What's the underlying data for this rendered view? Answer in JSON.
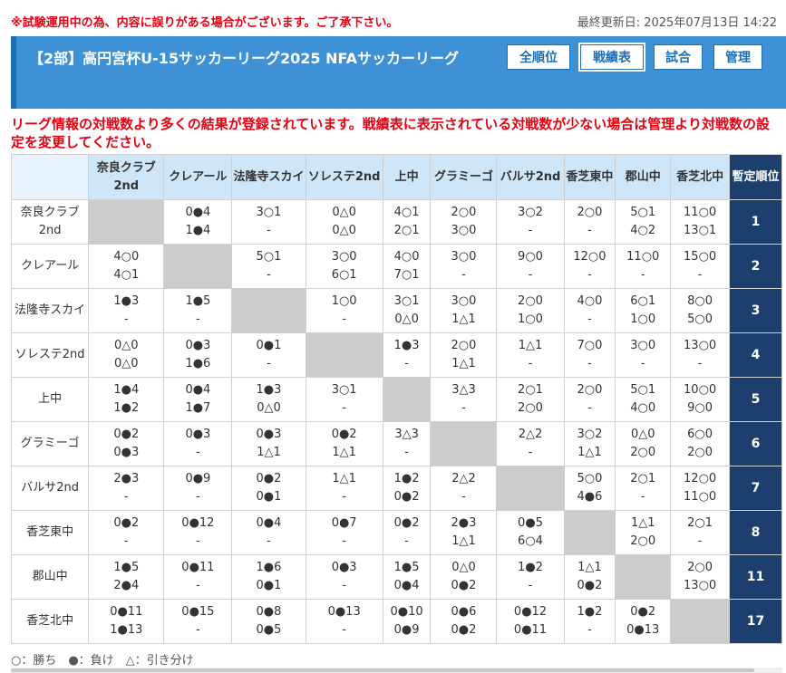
{
  "notice": "※試験運用中の為、内容に誤りがある場合がございます。ご了承下さい。",
  "updated": "最終更新日: 2025年07月13日 14:22",
  "league_title": "【2部】高円宮杯U-15サッカーリーグ2025 NFAサッカーリーグ",
  "nav": [
    "全順位",
    "戦績表",
    "試合",
    "管理"
  ],
  "warning": "リーグ情報の対戦数より多くの結果が登録されています。戦績表に表示されている対戦数が少ない場合は管理より対戦数の設定を変更してください。",
  "columns": [
    "奈良クラブ2nd",
    "クレアール",
    "法隆寺スカイ",
    "ソレステ2nd",
    "上中",
    "グラミーゴ",
    "バルサ2nd",
    "香芝東中",
    "郡山中",
    "香芝北中"
  ],
  "rank_header": "暫定順位",
  "rows": [
    {
      "team": "奈良クラブ2nd",
      "rank": "1",
      "cells": [
        null,
        [
          "0●4",
          "1●4"
        ],
        [
          "3○1",
          "-"
        ],
        [
          "0△0",
          "0△0"
        ],
        [
          "4○1",
          "2○1"
        ],
        [
          "2○0",
          "3○0"
        ],
        [
          "3○2",
          "-"
        ],
        [
          "2○0",
          "-"
        ],
        [
          "5○1",
          "4○2"
        ],
        [
          "11○0",
          "13○1"
        ]
      ]
    },
    {
      "team": "クレアール",
      "rank": "2",
      "cells": [
        [
          "4○0",
          "4○1"
        ],
        null,
        [
          "5○1",
          "-"
        ],
        [
          "3○0",
          "6○1"
        ],
        [
          "4○0",
          "7○1"
        ],
        [
          "3○0",
          "-"
        ],
        [
          "9○0",
          "-"
        ],
        [
          "12○0",
          "-"
        ],
        [
          "11○0",
          "-"
        ],
        [
          "15○0",
          "-"
        ]
      ]
    },
    {
      "team": "法隆寺スカイ",
      "rank": "3",
      "cells": [
        [
          "1●3",
          "-"
        ],
        [
          "1●5",
          "-"
        ],
        null,
        [
          "1○0",
          "-"
        ],
        [
          "3○1",
          "0△0"
        ],
        [
          "3○0",
          "1△1"
        ],
        [
          "2○0",
          "1○0"
        ],
        [
          "4○0",
          "-"
        ],
        [
          "6○1",
          "1○0"
        ],
        [
          "8○0",
          "5○0"
        ]
      ]
    },
    {
      "team": "ソレステ2nd",
      "rank": "4",
      "cells": [
        [
          "0△0",
          "0△0"
        ],
        [
          "0●3",
          "1●6"
        ],
        [
          "0●1",
          "-"
        ],
        null,
        [
          "1●3",
          "-"
        ],
        [
          "2○0",
          "1△1"
        ],
        [
          "1△1",
          "-"
        ],
        [
          "7○0",
          "-"
        ],
        [
          "3○0",
          "-"
        ],
        [
          "13○0",
          "-"
        ]
      ]
    },
    {
      "team": "上中",
      "rank": "5",
      "cells": [
        [
          "1●4",
          "1●2"
        ],
        [
          "0●4",
          "1●7"
        ],
        [
          "1●3",
          "0△0"
        ],
        [
          "3○1",
          "-"
        ],
        null,
        [
          "3△3",
          "-"
        ],
        [
          "2○1",
          "2○0"
        ],
        [
          "2○0",
          "-"
        ],
        [
          "5○1",
          "4○0"
        ],
        [
          "10○0",
          "9○0"
        ]
      ]
    },
    {
      "team": "グラミーゴ",
      "rank": "6",
      "cells": [
        [
          "0●2",
          "0●3"
        ],
        [
          "0●3",
          "-"
        ],
        [
          "0●3",
          "1△1"
        ],
        [
          "0●2",
          "1△1"
        ],
        [
          "3△3",
          "-"
        ],
        null,
        [
          "2△2",
          "-"
        ],
        [
          "3○2",
          "1△1"
        ],
        [
          "0△0",
          "2○0"
        ],
        [
          "6○0",
          "2○0"
        ]
      ]
    },
    {
      "team": "バルサ2nd",
      "rank": "7",
      "cells": [
        [
          "2●3",
          "-"
        ],
        [
          "0●9",
          "-"
        ],
        [
          "0●2",
          "0●1"
        ],
        [
          "1△1",
          "-"
        ],
        [
          "1●2",
          "0●2"
        ],
        [
          "2△2",
          "-"
        ],
        null,
        [
          "5○0",
          "4●6"
        ],
        [
          "2○1",
          "-"
        ],
        [
          "12○0",
          "11○0"
        ]
      ]
    },
    {
      "team": "香芝東中",
      "rank": "8",
      "cells": [
        [
          "0●2",
          "-"
        ],
        [
          "0●12",
          "-"
        ],
        [
          "0●4",
          "-"
        ],
        [
          "0●7",
          "-"
        ],
        [
          "0●2",
          "-"
        ],
        [
          "2●3",
          "1△1"
        ],
        [
          "0●5",
          "6○4"
        ],
        null,
        [
          "1△1",
          "2○0"
        ],
        [
          "2○1",
          "-"
        ]
      ]
    },
    {
      "team": "郡山中",
      "rank": "11",
      "cells": [
        [
          "1●5",
          "2●4"
        ],
        [
          "0●11",
          "-"
        ],
        [
          "1●6",
          "0●1"
        ],
        [
          "0●3",
          "-"
        ],
        [
          "1●5",
          "0●4"
        ],
        [
          "0△0",
          "0●2"
        ],
        [
          "1●2",
          "-"
        ],
        [
          "1△1",
          "0●2"
        ],
        null,
        [
          "2○0",
          "13○0"
        ]
      ]
    },
    {
      "team": "香芝北中",
      "rank": "17",
      "cells": [
        [
          "0●11",
          "1●13"
        ],
        [
          "0●15",
          "-"
        ],
        [
          "0●8",
          "0●5"
        ],
        [
          "0●13",
          "-"
        ],
        [
          "0●10",
          "0●9"
        ],
        [
          "0●6",
          "0●2"
        ],
        [
          "0●12",
          "0●11"
        ],
        [
          "1●2",
          "-"
        ],
        [
          "0●2",
          "0●13"
        ],
        null
      ]
    }
  ],
  "legend": "○：勝ち　●：負け　△：引き分け"
}
